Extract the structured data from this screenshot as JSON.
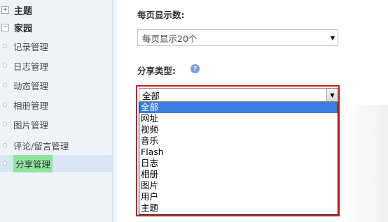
{
  "sidebar": {
    "topic": {
      "toggle": "+",
      "label": "主题"
    },
    "home": {
      "toggle": "−",
      "label": "家园",
      "items": [
        {
          "label": "记录管理"
        },
        {
          "label": "日志管理"
        },
        {
          "label": "动态管理"
        },
        {
          "label": "相册管理"
        },
        {
          "label": "图片管理"
        },
        {
          "label": "评论/留言管理"
        },
        {
          "label": "分享管理"
        }
      ],
      "selected": "分享管理"
    }
  },
  "main": {
    "per_page": {
      "label": "每页显示数:",
      "value": "每页显示20个"
    },
    "share_type": {
      "label": "分享类型:",
      "help_icon": "?",
      "value": "全部",
      "options": [
        "全部",
        "网址",
        "视频",
        "音乐",
        "Flash",
        "日志",
        "相册",
        "图片",
        "用户",
        "主题"
      ],
      "highlighted": "全部"
    }
  },
  "colors": {
    "sidebar_bg": "#eef3fa",
    "selected_item_bg": "#8fe6a0",
    "highlight_frame": "#d01c1c",
    "option_highlight": "#3a7ce0"
  }
}
